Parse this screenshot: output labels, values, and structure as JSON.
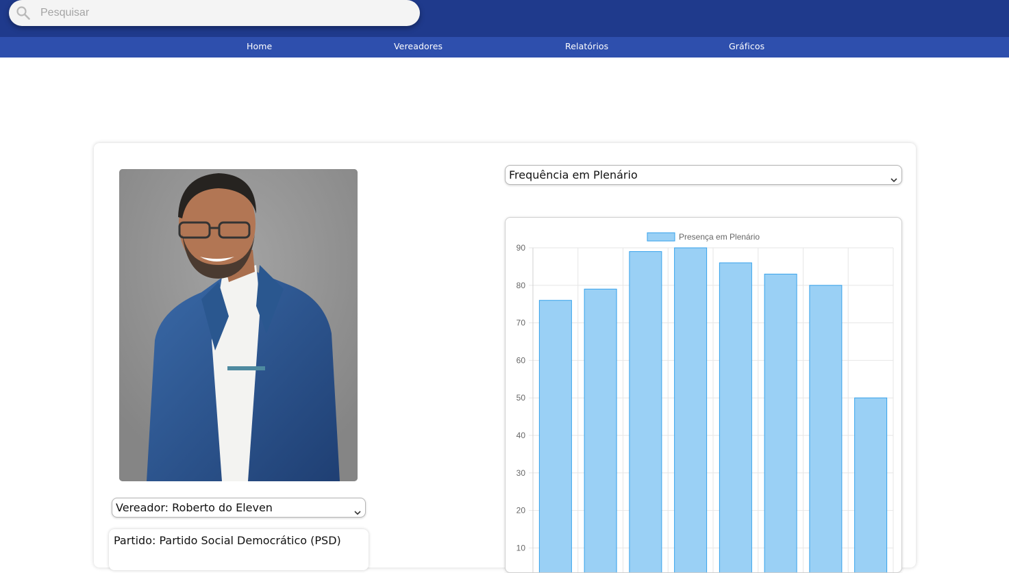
{
  "search": {
    "placeholder": "Pesquisar"
  },
  "nav": {
    "items": [
      {
        "label": "Home"
      },
      {
        "label": "Vereadores"
      },
      {
        "label": "Relatórios"
      },
      {
        "label": "Gráficos"
      }
    ]
  },
  "profile": {
    "vereador_select": "Vereador: Roberto do Eleven",
    "partido": "Partido: Partido Social Democrático (PSD)"
  },
  "chart_select": {
    "selected": "Frequência em Plenário"
  },
  "colors": {
    "header": "#1f3a8c",
    "navbar": "#2e4fad",
    "bar_fill": "#9ad0f5",
    "bar_border": "#36a2eb"
  },
  "chart_data": {
    "type": "bar",
    "series": [
      {
        "name": "Presença em Plenário",
        "values": [
          76,
          79,
          89,
          90,
          86,
          83,
          80,
          50
        ]
      }
    ],
    "yticks": [
      10,
      20,
      30,
      40,
      50,
      60,
      70,
      80,
      90
    ],
    "ylim": [
      0,
      90
    ],
    "grid": true,
    "legend": "top-center"
  }
}
